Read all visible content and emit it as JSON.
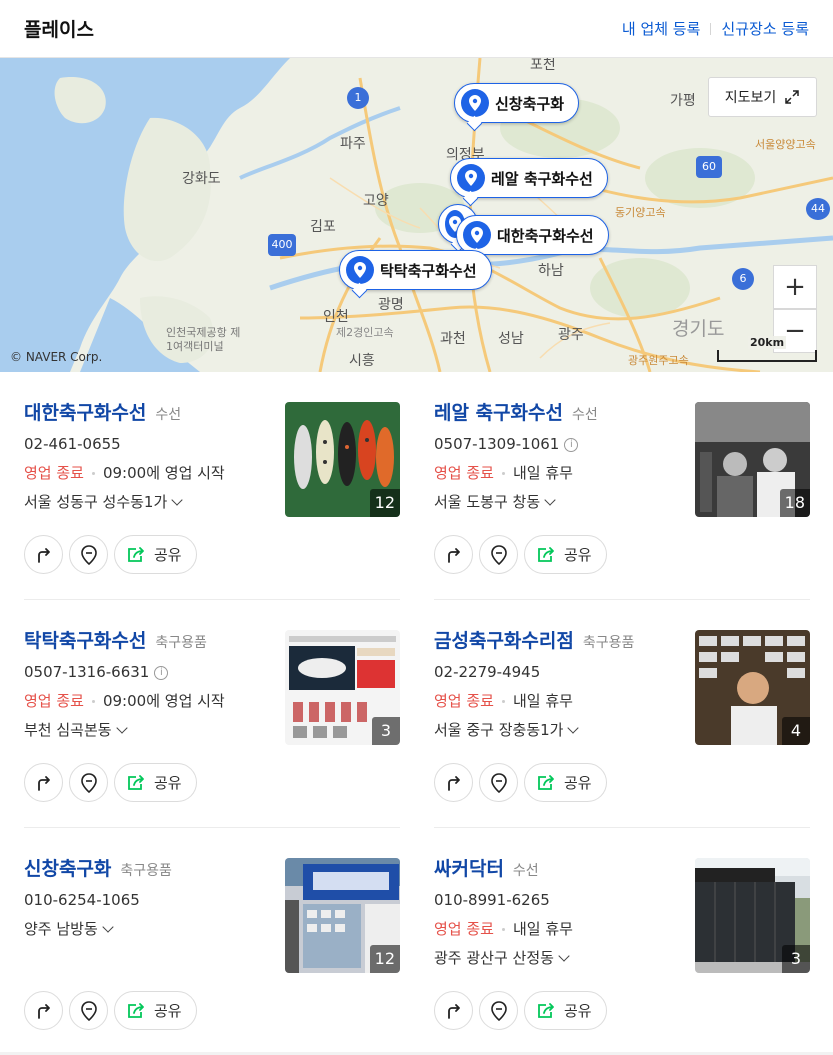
{
  "header": {
    "title": "플레이스",
    "link_register": "내 업체 등록",
    "link_new": "신규장소 등록"
  },
  "map": {
    "view_button": "지도보기",
    "zoom_in": "+",
    "zoom_out": "−",
    "copyright": "© NAVER Corp.",
    "scale": "20km",
    "labels": [
      "포천",
      "가평",
      "파주",
      "의정부",
      "강화도",
      "고양",
      "김포",
      "하남",
      "광명",
      "인천",
      "과천",
      "성남",
      "광주",
      "시흥",
      "경기도",
      "인천국제공항 제1여객터미널",
      "제2경인고속",
      "광주원주고속",
      "서울양양고속",
      "동기양고속"
    ],
    "road_shields": [
      "1",
      "60",
      "44",
      "6",
      "400"
    ],
    "pins": [
      "신창축구화",
      "레알 축구화수선",
      "대한축구화수선",
      "탁탁축구화수선"
    ]
  },
  "places": [
    {
      "name": "대한축구화수선",
      "category": "수선",
      "phone": "02-461-0655",
      "status": "영업 종료",
      "hours": "09:00에 영업 시작",
      "address": "서울 성동구 성수동1가",
      "photo_count": "12",
      "share": "공유"
    },
    {
      "name": "레알 축구화수선",
      "category": "수선",
      "phone": "0507-1309-1061",
      "status": "영업 종료",
      "hours": "내일 휴무",
      "address": "서울 도봉구 창동",
      "photo_count": "18",
      "share": "공유"
    },
    {
      "name": "탁탁축구화수선",
      "category": "축구용품",
      "phone": "0507-1316-6631",
      "status": "영업 종료",
      "hours": "09:00에 영업 시작",
      "address": "부천 심곡본동",
      "photo_count": "3",
      "share": "공유"
    },
    {
      "name": "금성축구화수리점",
      "category": "축구용품",
      "phone": "02-2279-4945",
      "status": "영업 종료",
      "hours": "내일 휴무",
      "address": "서울 중구 장충동1가",
      "photo_count": "4",
      "share": "공유"
    },
    {
      "name": "신창축구화",
      "category": "축구용품",
      "phone": "010-6254-1065",
      "address": "양주 남방동",
      "photo_count": "12",
      "share": "공유"
    },
    {
      "name": "싸커닥터",
      "category": "수선",
      "phone": "010-8991-6265",
      "status": "영업 종료",
      "hours": "내일 휴무",
      "address": "광주 광산구 산정동",
      "photo_count": "3",
      "share": "공유"
    }
  ],
  "colors": {
    "accent": "#1e63e6",
    "title_link": "#1147a6",
    "closed": "#e5524a",
    "share_green": "#03c75a"
  }
}
